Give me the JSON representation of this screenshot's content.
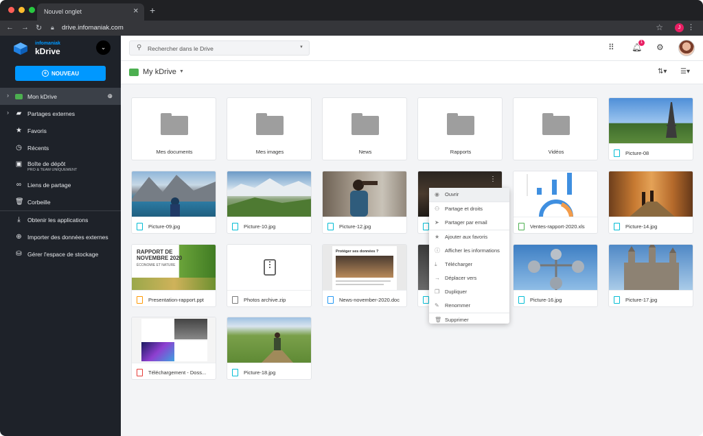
{
  "browser": {
    "tab_title": "Nouvel onglet",
    "url": "drive.infomaniak.com",
    "profile_initial": "J"
  },
  "brand": {
    "small": "infomaniak",
    "big": "kDrive"
  },
  "sidebar": {
    "new_button": "NOUVEAU",
    "items": [
      {
        "label": "Mon kDrive",
        "icon": "drive-icon"
      },
      {
        "label": "Partages externes",
        "icon": "shared-folder-icon"
      },
      {
        "label": "Favoris",
        "icon": "star-icon"
      },
      {
        "label": "Récents",
        "icon": "clock-icon"
      },
      {
        "label": "Boîte de dépôt",
        "sub": "PRO & TEAM UNIQUEMENT",
        "icon": "dropbox-icon"
      },
      {
        "label": "Liens de partage",
        "icon": "link-icon"
      },
      {
        "label": "Corbeille",
        "icon": "trash-icon"
      },
      {
        "label": "Obtenir les applications",
        "icon": "download-icon"
      },
      {
        "label": "Importer des données externes",
        "icon": "import-icon"
      },
      {
        "label": "Gérer l'espace de stockage",
        "icon": "storage-icon"
      }
    ]
  },
  "search": {
    "placeholder": "Rechercher dans le Drive"
  },
  "notifications": {
    "count": "1"
  },
  "drive": {
    "title": "My kDrive"
  },
  "folders": [
    {
      "name": "Mes documents"
    },
    {
      "name": "Mes images"
    },
    {
      "name": "News"
    },
    {
      "name": "Rapports"
    },
    {
      "name": "Vidéos"
    }
  ],
  "files": [
    {
      "name": "Picture-08",
      "type": "image"
    },
    {
      "name": "Picture-09.jpg",
      "type": "image"
    },
    {
      "name": "Picture-10.jpg",
      "type": "image"
    },
    {
      "name": "Picture-12.jpg",
      "type": "image"
    },
    {
      "name": "",
      "type": "image"
    },
    {
      "name": "Ventes-rapport-2020.xls",
      "type": "spreadsheet"
    },
    {
      "name": "Picture-14.jpg",
      "type": "image"
    },
    {
      "name": "Presentation-rapport.ppt",
      "type": "presentation"
    },
    {
      "name": "Photos archive.zip",
      "type": "archive"
    },
    {
      "name": "News-november-2020.doc",
      "type": "document"
    },
    {
      "name": "",
      "type": "image"
    },
    {
      "name": "Picture-16.jpg",
      "type": "image"
    },
    {
      "name": "Picture-17.jpg",
      "type": "image"
    },
    {
      "name": "Téléchargement - Doss...",
      "type": "pdf"
    },
    {
      "name": "Picture-18.jpg",
      "type": "image"
    }
  ],
  "thumb_text": {
    "report_title": "RAPPORT DE NOVEMBRE 2020",
    "report_sub": "ÉCONOMIE ET NATURE",
    "news_title": "Protéger ses données ?"
  },
  "context_menu": {
    "items": [
      "Ouvrir",
      "Partage et droits",
      "Partager par email",
      "Ajouter aux favoris",
      "Afficher les informations",
      "Télécharger",
      "Déplacer vers",
      "Dupliquer",
      "Renommer",
      "Supprimer"
    ]
  }
}
